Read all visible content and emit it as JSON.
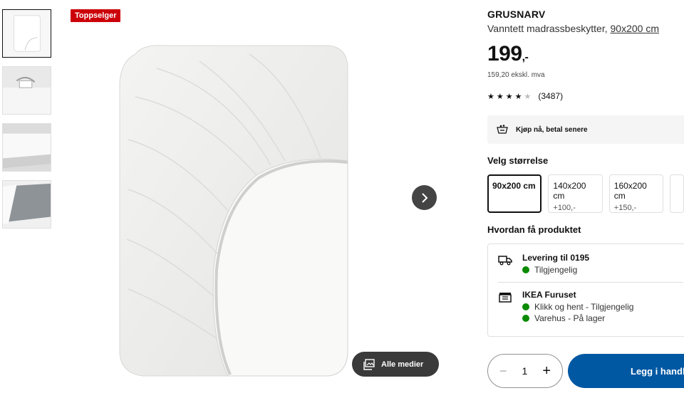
{
  "badge": "Toppselger",
  "product": {
    "brand": "GRUSNARV",
    "description": "Vanntett madrassbeskytter,",
    "size_link": "90x200 cm",
    "price_main": "199",
    "price_suffix": ",-",
    "price_excl": "159,20 ekskl. mva",
    "rating_value": 4.5,
    "rating_count": "(3487)"
  },
  "klarna": {
    "label": "Kjøp nå, betal senere",
    "icon": "klarna-icon"
  },
  "size_section": {
    "title": "Velg størrelse",
    "options": [
      {
        "label": "90x200 cm",
        "extra": ""
      },
      {
        "label": "140x200 cm",
        "extra": "+100,-"
      },
      {
        "label": "160x200 cm",
        "extra": "+150,-"
      }
    ]
  },
  "delivery_section": {
    "title": "Hvordan få produktet",
    "delivery": {
      "title": "Levering til 0195",
      "status": "Tilgjengelig",
      "icon": "truck-icon"
    },
    "store": {
      "title": "IKEA Furuset",
      "status_1": "Klikk og hent - Tilgjengelig",
      "status_2": "Varehus - På lager",
      "icon": "store-icon"
    }
  },
  "media": {
    "label": "Alle medier",
    "icon": "gallery-icon"
  },
  "cart": {
    "quantity": "1",
    "minus": "−",
    "plus": "+",
    "button_label": "Legg i handlekurv"
  },
  "colors": {
    "badge": "#cc0008",
    "cta": "#0058a3",
    "available": "#0a8a00"
  }
}
